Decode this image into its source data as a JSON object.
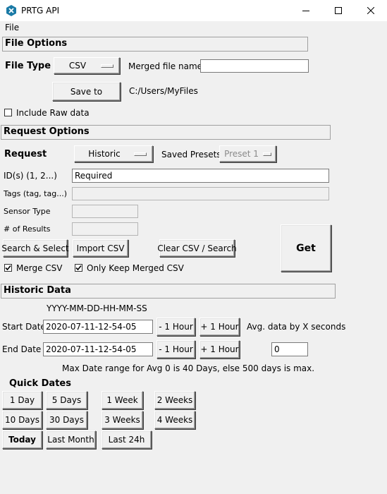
{
  "window": {
    "title": "PRTG API",
    "icon": "prtg-app-icon",
    "controls": [
      "minimize-icon",
      "maximize-icon",
      "close-icon"
    ]
  },
  "menu": {
    "file": "File"
  },
  "file_options": {
    "header": "File Options",
    "file_type_label": "File Type",
    "file_type_value": "CSV",
    "merged_name_label": "Merged file name",
    "merged_name_value": "",
    "save_to_label": "Save to",
    "save_path": "C:/Users/MyFiles",
    "include_raw_label": "Include Raw data",
    "include_raw_checked": false
  },
  "request_options": {
    "header": "Request Options",
    "request_label": "Request",
    "request_value": "Historic",
    "saved_presets_label": "Saved Presets",
    "preset_value": "Preset 1",
    "ids_label": "ID(s) (1, 2...)",
    "ids_value": "Required",
    "tags_label": "Tags (tag, tag...)",
    "tags_value": "",
    "sensor_type_label": "Sensor Type",
    "sensor_type_value": "",
    "results_label": "# of Results",
    "results_value": "",
    "search_select_label": "Search & Select",
    "import_csv_label": "Import CSV",
    "clear_csv_label": "Clear CSV / Search",
    "get_label": "Get",
    "merge_csv_label": "Merge CSV",
    "merge_csv_checked": true,
    "only_keep_label": "Only Keep Merged CSV",
    "only_keep_checked": true
  },
  "historic_data": {
    "header": "Historic Data",
    "format_hint": "YYYY-MM-DD-HH-MM-SS",
    "start_label": "Start Date",
    "start_value": "2020-07-11-12-54-05",
    "end_label": "End Date",
    "end_value": "2020-07-11-12-54-05",
    "minus_hour": "- 1 Hour",
    "plus_hour": "+ 1 Hour",
    "avg_label": "Avg. data by X seconds",
    "avg_value": "0",
    "range_note": "Max Date range for Avg 0 is 40 Days, else 500 days is max."
  },
  "quick_dates": {
    "header": "Quick Dates",
    "one_day": "1 Day",
    "five_days": "5 Days",
    "one_week": "1 Week",
    "two_weeks": "2 Weeks",
    "ten_days": "10 Days",
    "thirty_days": "30 Days",
    "three_weeks": "3 Weeks",
    "four_weeks": "4 Weeks",
    "today": "Today",
    "last_month": "Last Month",
    "last_24h": "Last 24h"
  }
}
